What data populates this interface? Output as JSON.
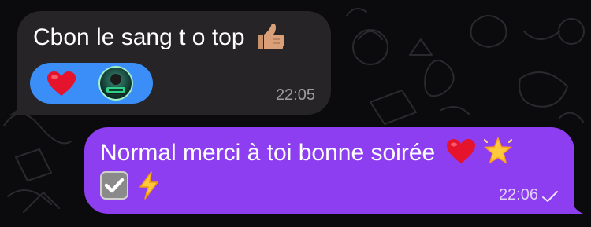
{
  "chat": {
    "messages": [
      {
        "direction": "incoming",
        "text": "Cbon le sang t o top",
        "emoji": "thumbs-up-medium-skin",
        "time": "22:05",
        "reactions": [
          {
            "type": "heart"
          },
          {
            "type": "avatar"
          }
        ]
      },
      {
        "direction": "outgoing",
        "text": "Normal merci à toi bonne soirée",
        "emojis_line1": [
          "red-heart",
          "glowing-star"
        ],
        "emojis_line2": [
          "check-mark-button",
          "high-voltage"
        ],
        "time": "22:06",
        "status_icon": "check-icon"
      }
    ]
  },
  "colors": {
    "background": "#0b0b0d",
    "incoming_bubble": "#262426",
    "outgoing_bubble": "#8c3ef0",
    "reaction_pill": "#3b8ef7"
  }
}
